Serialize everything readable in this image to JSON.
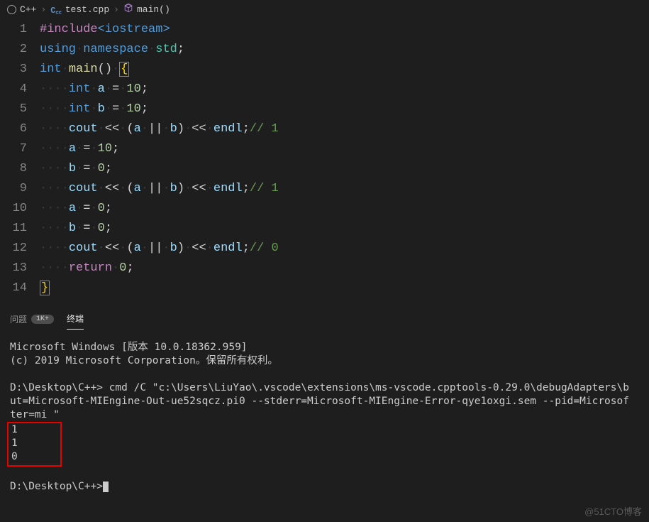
{
  "breadcrumb": {
    "item1": "C++",
    "item2": "test.cpp",
    "item3": "main()"
  },
  "editor": {
    "lines": [
      "1",
      "2",
      "3",
      "4",
      "5",
      "6",
      "7",
      "8",
      "9",
      "10",
      "11",
      "12",
      "13",
      "14"
    ],
    "code": {
      "l1_macro": "#include",
      "l1_header": "<iostream>",
      "l2_using": "using",
      "l2_namespace": "namespace",
      "l2_std": "std",
      "l3_int": "int",
      "l3_main": "main",
      "l4_int": "int",
      "l4_a": "a",
      "l4_eq": "=",
      "l4_10": "10",
      "l5_int": "int",
      "l5_b": "b",
      "l5_10": "10",
      "l6_cout": "cout",
      "l6_a": "a",
      "l6_or": "||",
      "l6_b": "b",
      "l6_endl": "endl",
      "l6_c": "// 1",
      "l7_a": "a",
      "l7_10": "10",
      "l8_b": "b",
      "l8_0": "0",
      "l9_cout": "cout",
      "l9_a": "a",
      "l9_or": "||",
      "l9_b": "b",
      "l9_endl": "endl",
      "l9_c": "// 1",
      "l10_a": "a",
      "l10_0": "0",
      "l11_b": "b",
      "l11_0": "0",
      "l12_cout": "cout",
      "l12_a": "a",
      "l12_or": "||",
      "l12_b": "b",
      "l12_endl": "endl",
      "l12_c": "// 0",
      "l13_return": "return",
      "l13_0": "0"
    }
  },
  "panel": {
    "tab_problems": "问题",
    "tab_problems_badge": "1K+",
    "tab_terminal": "终端"
  },
  "terminal": {
    "line1": "Microsoft Windows [版本 10.0.18362.959]",
    "line2": "(c) 2019 Microsoft Corporation。保留所有权利。",
    "prompt1": "D:\\Desktop\\C++>",
    "cmd1a": " cmd /C \"c:\\Users\\LiuYao\\.vscode\\extensions\\ms-vscode.cpptools-0.29.0\\debugAdapters\\b",
    "cmd1b": "ut=Microsoft-MIEngine-Out-ue52sqcz.pi0 --stderr=Microsoft-MIEngine-Error-qye1oxgi.sem --pid=Microsof",
    "cmd1c": "ter=mi \"",
    "out1": "1",
    "out2": "1",
    "out3": "0",
    "prompt2": "D:\\Desktop\\C++>"
  },
  "watermark": "@51CTO博客"
}
